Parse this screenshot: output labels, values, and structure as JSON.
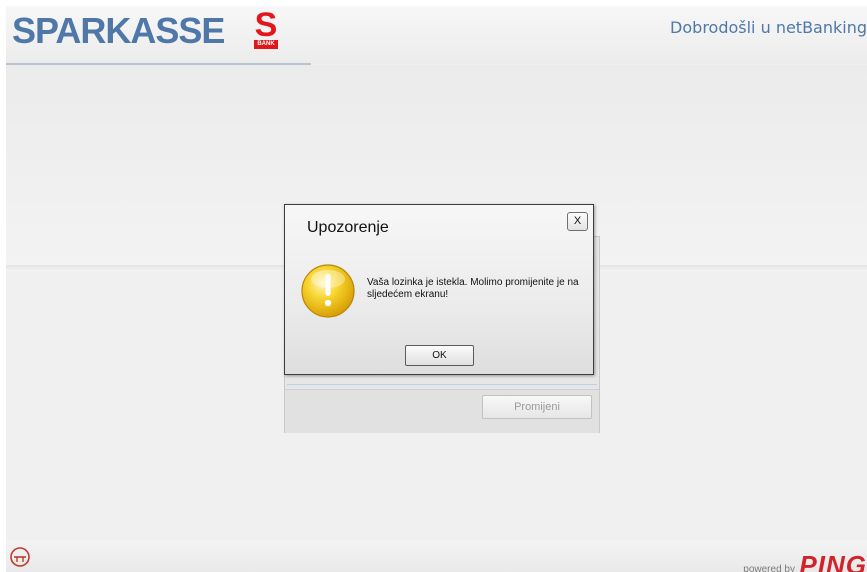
{
  "header": {
    "logo_text": "SPARKASSE",
    "logo_mark": "S",
    "logo_bank": "BANK",
    "welcome": "Dobrodošli u netBanking"
  },
  "panel": {
    "change_label": "Promijeni"
  },
  "dialog": {
    "title": "Upozorenje",
    "close_label": "X",
    "icon": "warning-exclamation-icon",
    "message": "Vaša lozinka je istekla. Molimo promijenite je na sljedećem ekranu!",
    "ok_label": "OK"
  },
  "footer": {
    "icon": "power-plug-icon",
    "powered_text": "powered by",
    "brand": "PING"
  },
  "colors": {
    "brand_blue": "#4f78a8",
    "brand_red": "#e3171b",
    "ping_red": "#d1232a",
    "warning_yellow": "#f2c21a"
  }
}
